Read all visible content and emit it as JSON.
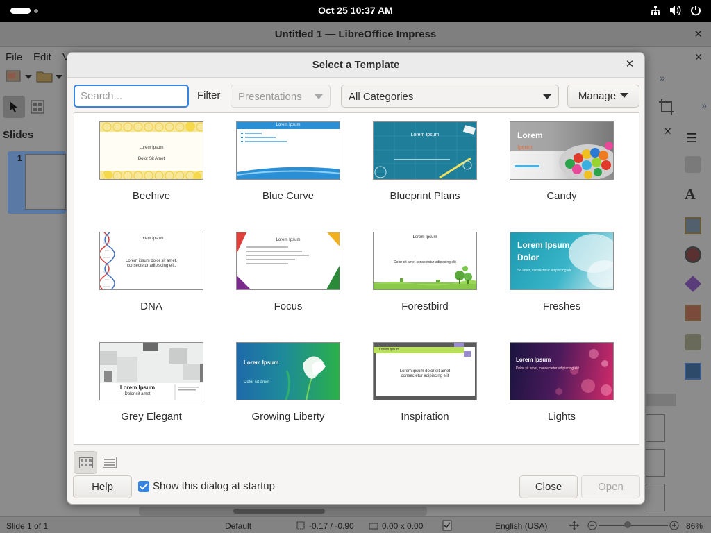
{
  "topbar": {
    "clock": "Oct 25  10:37 AM",
    "tray_icons": [
      "network-icon",
      "volume-icon",
      "power-icon"
    ]
  },
  "app": {
    "title": "Untitled 1 — LibreOffice Impress",
    "menu": [
      "File",
      "Edit",
      "V"
    ],
    "slides_panel_title": "Slides",
    "slide_number": "1"
  },
  "statusbar": {
    "slide": "Slide 1 of 1",
    "layout": "Default",
    "position": "-0.17 / -0.90",
    "size": "0.00 x 0.00",
    "language": "English (USA)",
    "zoom": "86%"
  },
  "dialog": {
    "title": "Select a Template",
    "search_placeholder": "Search...",
    "filter_label": "Filter",
    "filter_value": "Presentations",
    "category_value": "All Categories",
    "manage_label": "Manage",
    "help_label": "Help",
    "startup_label": "Show this dialog at startup",
    "startup_checked": true,
    "close_label": "Close",
    "open_label": "Open",
    "templates": [
      {
        "name": "Beehive",
        "lines": [
          "Lorem Ipsum",
          "Dolor Sit Amet"
        ]
      },
      {
        "name": "Blue Curve",
        "lines": [
          "Lorem Ipsum"
        ]
      },
      {
        "name": "Blueprint Plans",
        "lines": [
          "Lorem Ipsum"
        ]
      },
      {
        "name": "Candy",
        "lines": [
          "Lorem",
          "Ipsum"
        ]
      },
      {
        "name": "DNA",
        "lines": [
          "Lorem Ipsum",
          "Lorem ipsum dolor sit amet,",
          "consectetur adipiscing elit."
        ]
      },
      {
        "name": "Focus",
        "lines": [
          "Lorem Ipsum"
        ]
      },
      {
        "name": "Forestbird",
        "lines": [
          "Lorem Ipsum",
          "Dolor sit amet consectetur adipiscing elit"
        ]
      },
      {
        "name": "Freshes",
        "lines": [
          "Lorem Ipsum",
          "Dolor",
          "Sit amet, consectetur adipiscing elit"
        ]
      },
      {
        "name": "Grey Elegant",
        "lines": [
          "Lorem Ipsum",
          "Dolor sit amet"
        ]
      },
      {
        "name": "Growing Liberty",
        "lines": [
          "Lorem Ipsum",
          "Dolor sit amet"
        ]
      },
      {
        "name": "Inspiration",
        "lines": [
          "Lorem Ipsum",
          "Lorem ipsum dolor sit amet",
          "consectetur adipiscing elit"
        ]
      },
      {
        "name": "Lights",
        "lines": [
          "Lorem Ipsum",
          "Dolor sit amet, consectetur adipiscing elit"
        ]
      }
    ]
  }
}
